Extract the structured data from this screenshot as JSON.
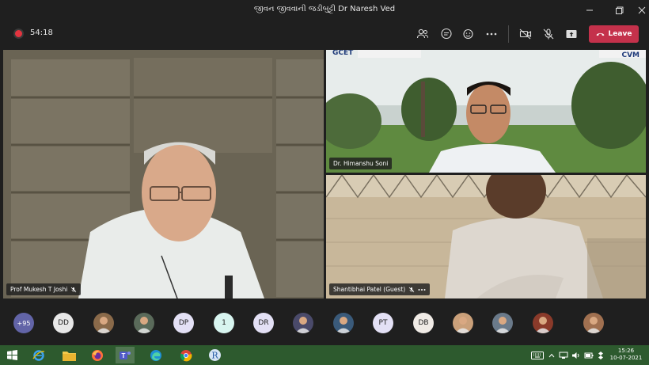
{
  "window": {
    "title": "જીવન જીવવાની જડીબુટ્ટી Dr Naresh Ved"
  },
  "toolbar": {
    "timer": "54:18",
    "leave_label": "Leave"
  },
  "participants_video": [
    {
      "name": "Prof Mukesh T Joshi"
    },
    {
      "name": "Dr. Himanshu Soni"
    },
    {
      "name": "Shantibhai Patel (Guest)"
    }
  ],
  "video_overlay_text": {
    "left_logo": "GCET",
    "right_logo": "CVM"
  },
  "strip": {
    "overflow_count": "+95",
    "avatars": [
      {
        "initials": "DD",
        "bg": "#e8e8e8"
      },
      {
        "initials": "",
        "photo": true,
        "bg": "#8a6a4a"
      },
      {
        "initials": "",
        "photo": true,
        "bg": "#5a6a5a"
      },
      {
        "initials": "DP",
        "bg": "#e3e0f5"
      },
      {
        "initials": "1",
        "bg": "#d8f5f0"
      },
      {
        "initials": "DR",
        "bg": "#e3e0f5"
      },
      {
        "initials": "",
        "photo": true,
        "bg": "#4a4a6a"
      },
      {
        "initials": "",
        "photo": true,
        "bg": "#3a5a7a"
      },
      {
        "initials": "PT",
        "bg": "#e3e0f5"
      },
      {
        "initials": "DB",
        "bg": "#f0ebe6"
      },
      {
        "initials": "",
        "photo": true,
        "bg": "#caa07a"
      },
      {
        "initials": "",
        "photo": true,
        "bg": "#6a7a8a"
      },
      {
        "initials": "",
        "photo": true,
        "bg": "#8a3a2a"
      },
      {
        "initials": "",
        "photo": true,
        "bg": "#a07050"
      }
    ]
  },
  "taskbar": {
    "time": "15:26",
    "date": "10-07-2021",
    "apps": [
      "windows-start",
      "internet-explorer",
      "file-explorer",
      "firefox",
      "teams",
      "edge",
      "chrome",
      "r-app"
    ]
  },
  "colors": {
    "leave": "#c4314b",
    "overflow_badge": "#6264a7",
    "taskbar": "#2d5a2e"
  }
}
